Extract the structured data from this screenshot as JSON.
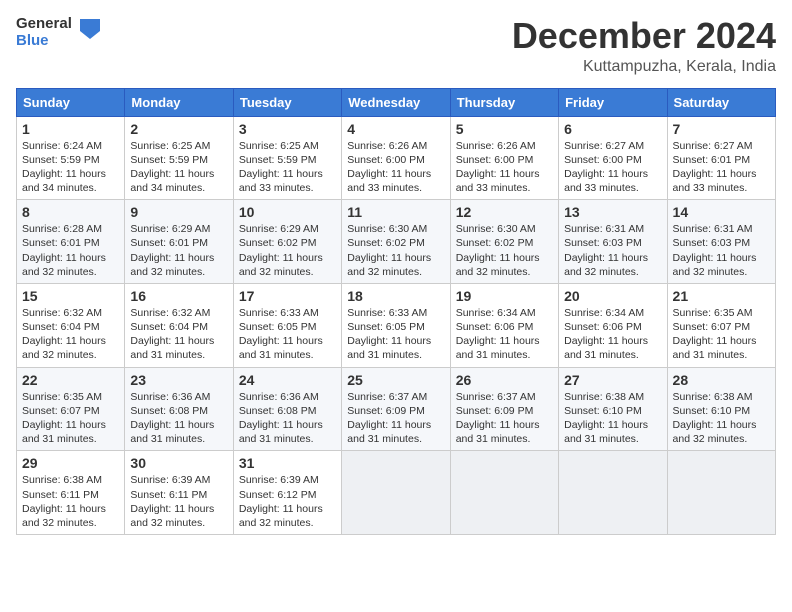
{
  "header": {
    "logo_general": "General",
    "logo_blue": "Blue",
    "month_title": "December 2024",
    "location": "Kuttampuzha, Kerala, India"
  },
  "weekdays": [
    "Sunday",
    "Monday",
    "Tuesday",
    "Wednesday",
    "Thursday",
    "Friday",
    "Saturday"
  ],
  "weeks": [
    [
      {
        "day": "1",
        "sunrise": "6:24 AM",
        "sunset": "5:59 PM",
        "daylight": "11 hours and 34 minutes."
      },
      {
        "day": "2",
        "sunrise": "6:25 AM",
        "sunset": "5:59 PM",
        "daylight": "11 hours and 34 minutes."
      },
      {
        "day": "3",
        "sunrise": "6:25 AM",
        "sunset": "5:59 PM",
        "daylight": "11 hours and 33 minutes."
      },
      {
        "day": "4",
        "sunrise": "6:26 AM",
        "sunset": "6:00 PM",
        "daylight": "11 hours and 33 minutes."
      },
      {
        "day": "5",
        "sunrise": "6:26 AM",
        "sunset": "6:00 PM",
        "daylight": "11 hours and 33 minutes."
      },
      {
        "day": "6",
        "sunrise": "6:27 AM",
        "sunset": "6:00 PM",
        "daylight": "11 hours and 33 minutes."
      },
      {
        "day": "7",
        "sunrise": "6:27 AM",
        "sunset": "6:01 PM",
        "daylight": "11 hours and 33 minutes."
      }
    ],
    [
      {
        "day": "8",
        "sunrise": "6:28 AM",
        "sunset": "6:01 PM",
        "daylight": "11 hours and 32 minutes."
      },
      {
        "day": "9",
        "sunrise": "6:29 AM",
        "sunset": "6:01 PM",
        "daylight": "11 hours and 32 minutes."
      },
      {
        "day": "10",
        "sunrise": "6:29 AM",
        "sunset": "6:02 PM",
        "daylight": "11 hours and 32 minutes."
      },
      {
        "day": "11",
        "sunrise": "6:30 AM",
        "sunset": "6:02 PM",
        "daylight": "11 hours and 32 minutes."
      },
      {
        "day": "12",
        "sunrise": "6:30 AM",
        "sunset": "6:02 PM",
        "daylight": "11 hours and 32 minutes."
      },
      {
        "day": "13",
        "sunrise": "6:31 AM",
        "sunset": "6:03 PM",
        "daylight": "11 hours and 32 minutes."
      },
      {
        "day": "14",
        "sunrise": "6:31 AM",
        "sunset": "6:03 PM",
        "daylight": "11 hours and 32 minutes."
      }
    ],
    [
      {
        "day": "15",
        "sunrise": "6:32 AM",
        "sunset": "6:04 PM",
        "daylight": "11 hours and 32 minutes."
      },
      {
        "day": "16",
        "sunrise": "6:32 AM",
        "sunset": "6:04 PM",
        "daylight": "11 hours and 31 minutes."
      },
      {
        "day": "17",
        "sunrise": "6:33 AM",
        "sunset": "6:05 PM",
        "daylight": "11 hours and 31 minutes."
      },
      {
        "day": "18",
        "sunrise": "6:33 AM",
        "sunset": "6:05 PM",
        "daylight": "11 hours and 31 minutes."
      },
      {
        "day": "19",
        "sunrise": "6:34 AM",
        "sunset": "6:06 PM",
        "daylight": "11 hours and 31 minutes."
      },
      {
        "day": "20",
        "sunrise": "6:34 AM",
        "sunset": "6:06 PM",
        "daylight": "11 hours and 31 minutes."
      },
      {
        "day": "21",
        "sunrise": "6:35 AM",
        "sunset": "6:07 PM",
        "daylight": "11 hours and 31 minutes."
      }
    ],
    [
      {
        "day": "22",
        "sunrise": "6:35 AM",
        "sunset": "6:07 PM",
        "daylight": "11 hours and 31 minutes."
      },
      {
        "day": "23",
        "sunrise": "6:36 AM",
        "sunset": "6:08 PM",
        "daylight": "11 hours and 31 minutes."
      },
      {
        "day": "24",
        "sunrise": "6:36 AM",
        "sunset": "6:08 PM",
        "daylight": "11 hours and 31 minutes."
      },
      {
        "day": "25",
        "sunrise": "6:37 AM",
        "sunset": "6:09 PM",
        "daylight": "11 hours and 31 minutes."
      },
      {
        "day": "26",
        "sunrise": "6:37 AM",
        "sunset": "6:09 PM",
        "daylight": "11 hours and 31 minutes."
      },
      {
        "day": "27",
        "sunrise": "6:38 AM",
        "sunset": "6:10 PM",
        "daylight": "11 hours and 31 minutes."
      },
      {
        "day": "28",
        "sunrise": "6:38 AM",
        "sunset": "6:10 PM",
        "daylight": "11 hours and 32 minutes."
      }
    ],
    [
      {
        "day": "29",
        "sunrise": "6:38 AM",
        "sunset": "6:11 PM",
        "daylight": "11 hours and 32 minutes."
      },
      {
        "day": "30",
        "sunrise": "6:39 AM",
        "sunset": "6:11 PM",
        "daylight": "11 hours and 32 minutes."
      },
      {
        "day": "31",
        "sunrise": "6:39 AM",
        "sunset": "6:12 PM",
        "daylight": "11 hours and 32 minutes."
      },
      null,
      null,
      null,
      null
    ]
  ]
}
